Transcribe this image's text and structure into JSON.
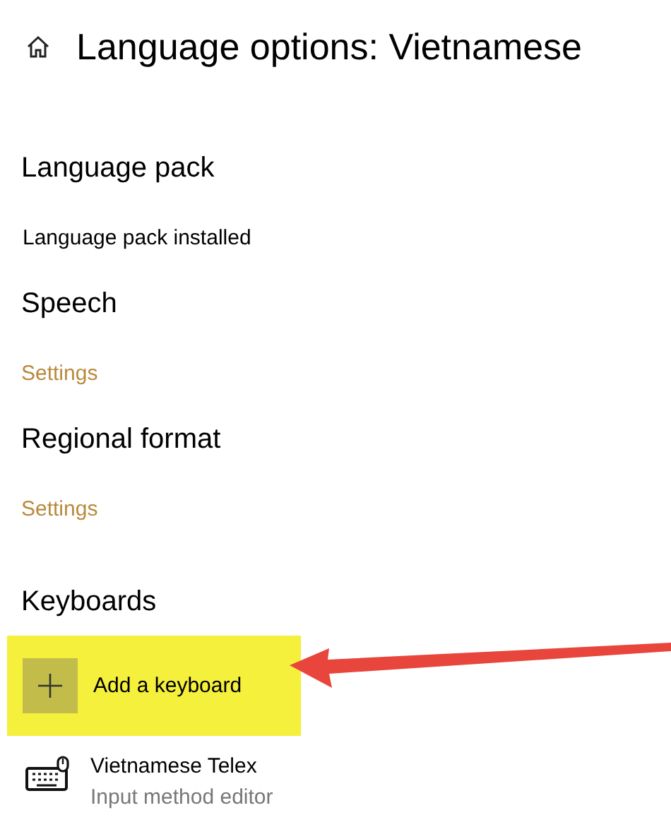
{
  "header": {
    "title": "Language options: Vietnamese"
  },
  "sections": [
    {
      "heading": "Language pack",
      "kind": "text",
      "text": "Language pack installed"
    },
    {
      "heading": "Speech",
      "kind": "link",
      "text": "Settings"
    },
    {
      "heading": "Regional format",
      "kind": "link",
      "text": "Settings"
    }
  ],
  "keyboards": {
    "heading": "Keyboards",
    "add_button": {
      "label": "Add a keyboard",
      "highlighted": true,
      "arrow": true
    },
    "items": [
      {
        "name": "Vietnamese Telex",
        "description": "Input method editor"
      }
    ]
  }
}
